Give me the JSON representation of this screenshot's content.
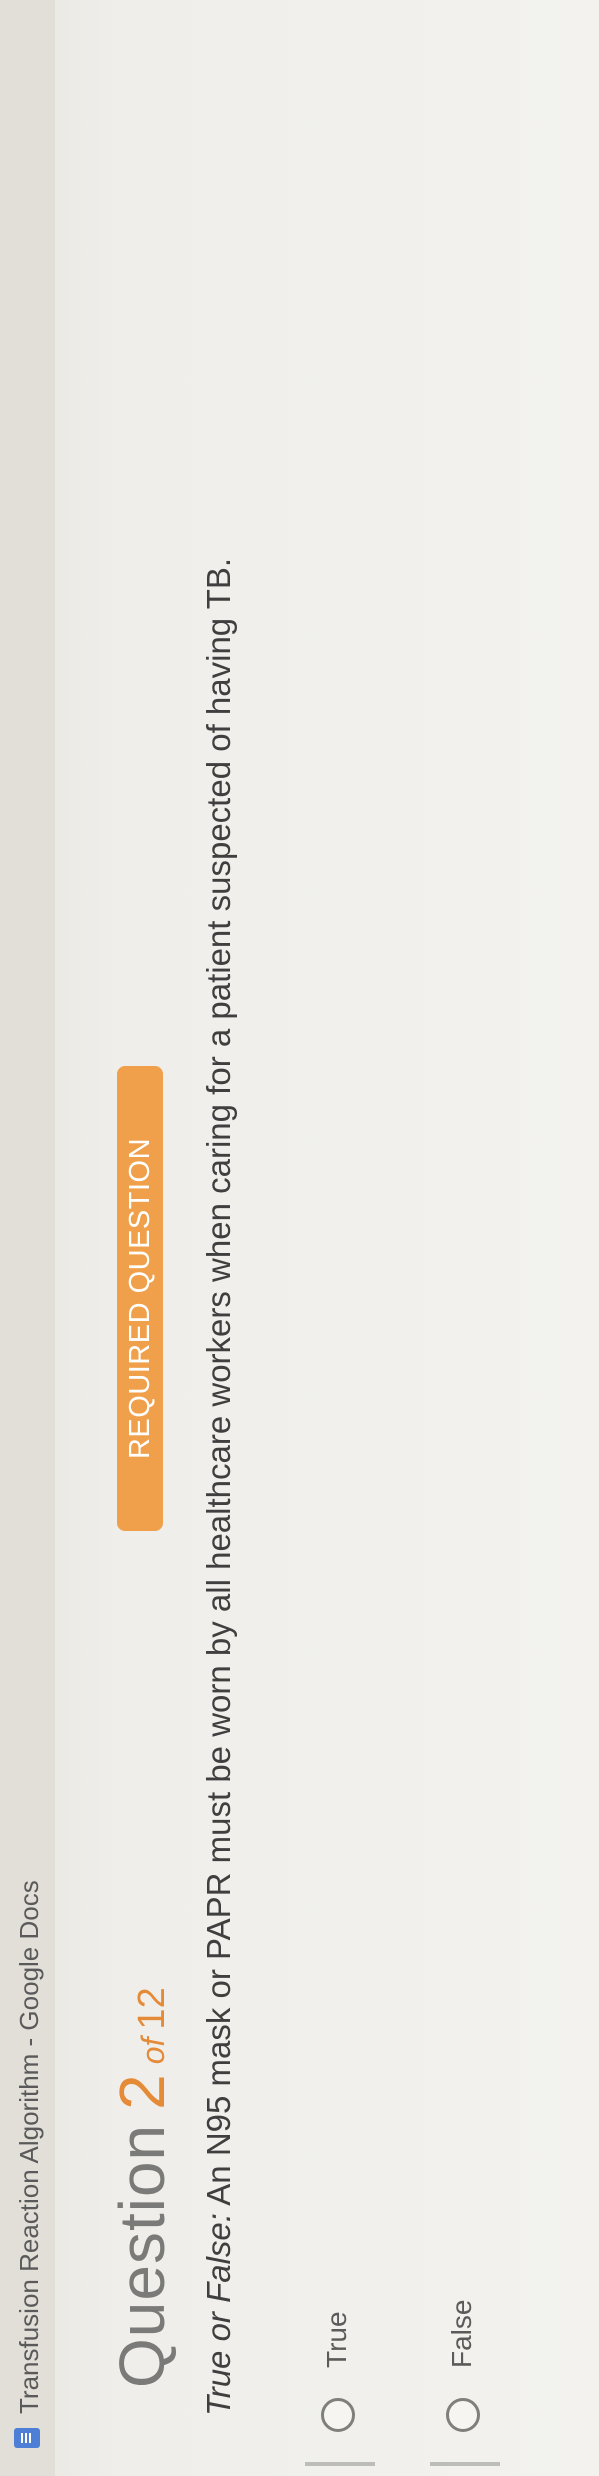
{
  "browser": {
    "tab_title": "Transfusion Reaction Algorithm - Google Docs"
  },
  "question": {
    "word": "Question",
    "number": "2",
    "of": "of",
    "total": "12",
    "badge": "REQUIRED QUESTION",
    "prompt_lead": "True or False:",
    "prompt_text": " An N95 mask or PAPR must be worn by all healthcare workers when caring for a patient suspected of having TB."
  },
  "options": [
    {
      "label": "True"
    },
    {
      "label": "False"
    }
  ],
  "colors": {
    "accent": "#e58a37",
    "badge_bg": "#f0a04a"
  },
  "icons": {
    "doc": "docs-icon",
    "radio": "radio-empty"
  }
}
